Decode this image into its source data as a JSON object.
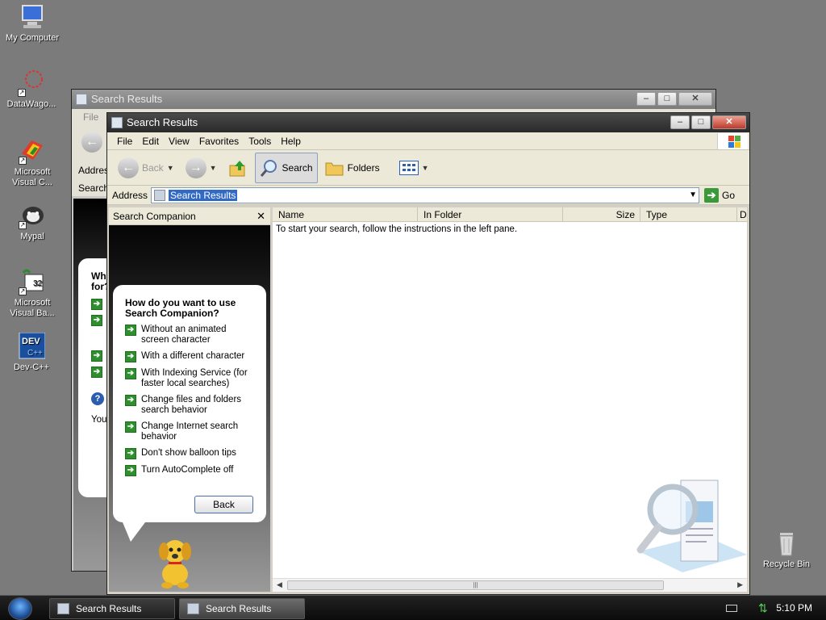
{
  "desktop": {
    "icons": [
      {
        "label": "My Computer"
      },
      {
        "label": "DataWago..."
      },
      {
        "label": "Microsoft\nVisual C..."
      },
      {
        "label": "Mypal"
      },
      {
        "label": "Microsoft\nVisual Ba..."
      },
      {
        "label": "Dev-C++"
      },
      {
        "label": "Recycle Bin"
      }
    ]
  },
  "back_window": {
    "title": "Search Results",
    "menu_first": "File",
    "address_label": "Addres",
    "search_tab": "Search",
    "balloon_partial": [
      "What",
      "for?"
    ],
    "you_partial": "You"
  },
  "window": {
    "title": "Search Results",
    "menu": [
      "File",
      "Edit",
      "View",
      "Favorites",
      "Tools",
      "Help"
    ],
    "toolbar": {
      "back": "Back",
      "search": "Search",
      "folders": "Folders"
    },
    "address": {
      "label": "Address",
      "value": "Search Results",
      "go": "Go"
    },
    "left_pane": {
      "header": "Search Companion",
      "close_glyph": "✕",
      "balloon": {
        "title": "How do you want to use Search Companion?",
        "options": [
          "Without an animated screen character",
          "With a different character",
          "With Indexing Service (for faster local searches)",
          "Change files and folders search behavior",
          "Change Internet search behavior",
          "Don't show balloon tips",
          "Turn AutoComplete off"
        ],
        "back_button": "Back"
      }
    },
    "results": {
      "columns": [
        "Name",
        "In Folder",
        "Size",
        "Type",
        "D"
      ],
      "empty_message": "To start your search, follow the instructions in the left pane."
    }
  },
  "taskbar": {
    "buttons": [
      {
        "label": "Search Results",
        "active": false
      },
      {
        "label": "Search Results",
        "active": true
      }
    ],
    "clock": "5:10 PM"
  }
}
